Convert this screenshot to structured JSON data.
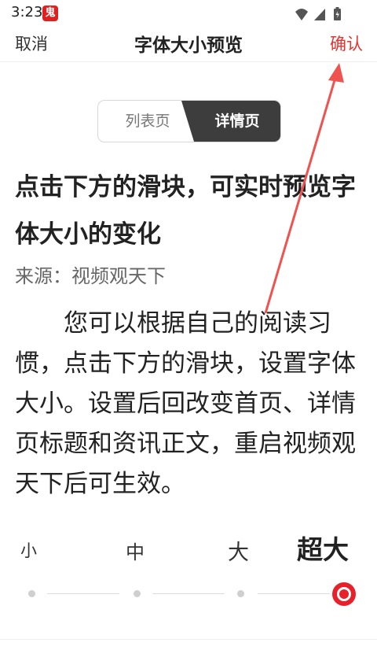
{
  "status": {
    "time": "3:23",
    "app_badge": "鬼"
  },
  "header": {
    "cancel": "取消",
    "title": "字体大小预览",
    "confirm": "确认"
  },
  "tabs": {
    "list": "列表页",
    "detail": "详情页",
    "selected": "详情页"
  },
  "article": {
    "headline": "点击下方的滑块，可实时预览字体大小的变化",
    "source": "来源：视频观天下",
    "body": "您可以根据自己的阅读习惯，点击下方的滑块，设置字体大小。设置后回改变首页、详情页标题和资讯正文，重启视频观天下后可生效。"
  },
  "font_size": {
    "options": [
      "小",
      "中",
      "大",
      "超大"
    ],
    "selected": "超大"
  },
  "colors": {
    "accent": "#e8322f",
    "tab_active": "#3d3d3d",
    "annotation_arrow": "#ef5350"
  },
  "icons": [
    "wifi-icon",
    "signal-icon",
    "battery-icon"
  ]
}
